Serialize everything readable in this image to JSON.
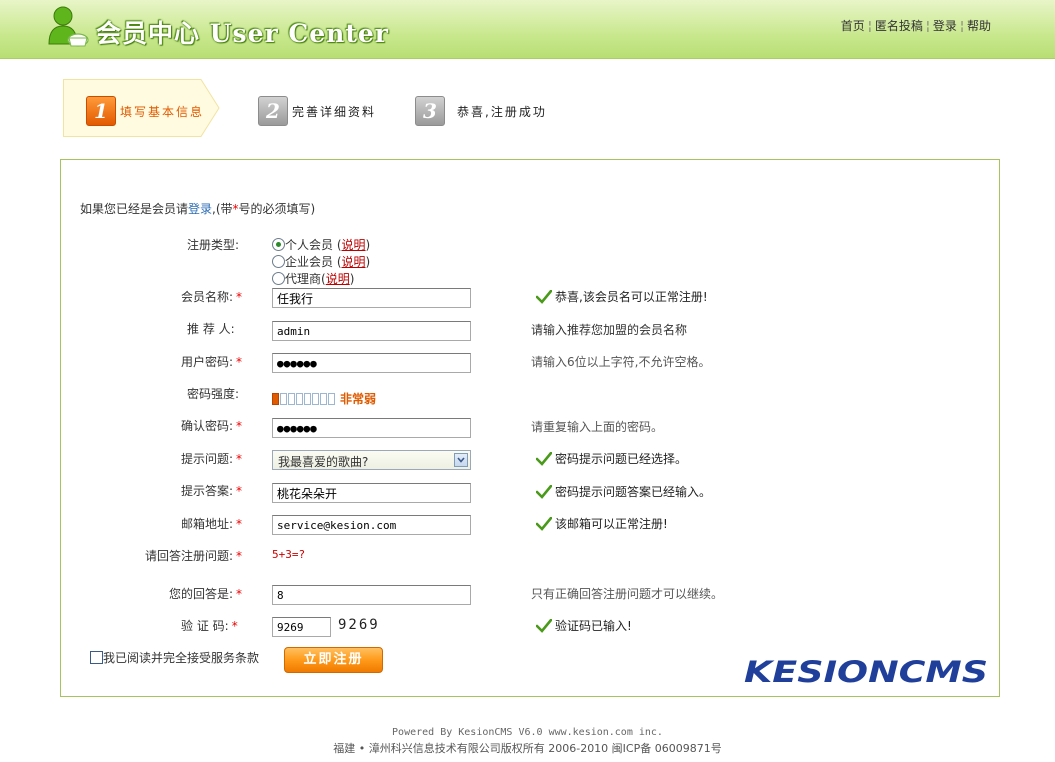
{
  "header": {
    "title": "会员中心 User Center",
    "nav": [
      "首页",
      "匿名投稿",
      "登录",
      "帮助"
    ]
  },
  "steps": [
    {
      "num": "1",
      "label": "填写基本信息",
      "active": true
    },
    {
      "num": "2",
      "label": "完善详细资料",
      "active": false
    },
    {
      "num": "3",
      "label": "恭喜,注册成功",
      "active": false
    }
  ],
  "intro": {
    "before": "如果您已经是会员请",
    "login": "登录",
    "middle": ",(带",
    "star": "*",
    "after": "号的必须填写)"
  },
  "form": {
    "reg_type_label": "注册类型:",
    "reg_types": [
      {
        "label": "个人会员",
        "explain": "说明",
        "checked": true
      },
      {
        "label": "企业会员",
        "explain": "说明",
        "checked": false
      },
      {
        "label": "代理商",
        "explain": "说明",
        "checked": false
      }
    ],
    "username_label": "会员名称:",
    "username_value": "任我行",
    "username_ok": "恭喜,该会员名可以正常注册!",
    "referrer_label": "推 荐 人:",
    "referrer_value": "admin",
    "referrer_hint": "请输入推荐您加盟的会员名称",
    "password_label": "用户密码:",
    "password_value": "●●●●●●",
    "password_hint": "请输入6位以上字符,不允许空格。",
    "strength_label": "密码强度:",
    "strength_level": 1,
    "strength_total": 8,
    "strength_text": "非常弱",
    "confirm_label": "确认密码:",
    "confirm_value": "●●●●●●",
    "confirm_hint": "请重复输入上面的密码。",
    "question_label": "提示问题:",
    "question_value": "我最喜爱的歌曲?",
    "question_ok": "密码提示问题已经选择。",
    "answer_label": "提示答案:",
    "answer_value": "桃花朵朵开",
    "answer_ok": "密码提示问题答案已经输入。",
    "email_label": "邮箱地址:",
    "email_value": "service@kesion.com",
    "email_ok": "该邮箱可以正常注册!",
    "reg_question_label": "请回答注册问题:",
    "reg_question": "5+3=?",
    "reg_answer_label": "您的回答是:",
    "reg_answer_value": "8",
    "reg_answer_hint": "只有正确回答注册问题才可以继续。",
    "captcha_label": "验 证 码:",
    "captcha_value": "9269",
    "captcha_image_text": "9269",
    "captcha_ok": "验证码已输入!",
    "required_mark": "*",
    "agree_label": "我已阅读并完全接受服务条款",
    "submit_label": "立即注册"
  },
  "brand": "KESIONCMS",
  "colors": {
    "accent_orange": "#e05a00",
    "ok_green": "#4a9a1a",
    "border_green": "#a6c45e",
    "required_red": "#e00000"
  },
  "footer": {
    "line1": "Powered By KesionCMS V6.0 www.kesion.com inc.",
    "line2": "福建 • 漳州科兴信息技术有限公司版权所有 2006-2010 闽ICP备 06009871号"
  }
}
